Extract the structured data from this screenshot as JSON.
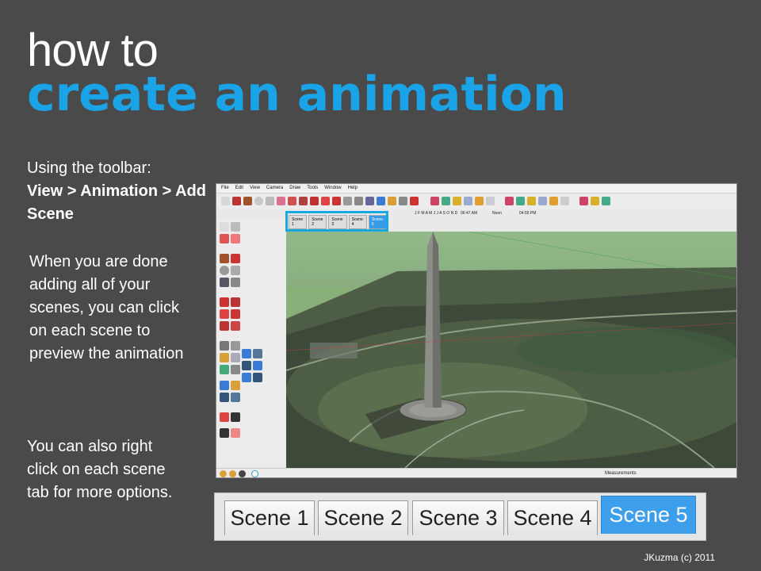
{
  "title": {
    "line1": "how to",
    "line2": "create an animation"
  },
  "instructions": {
    "intro": "Using the toolbar:",
    "path": "View > Animation > Add Scene",
    "preview": "When you are done adding all of your scenes, you can click on each scene to preview the animation",
    "right_click": "You can also right click on each scene tab for more options."
  },
  "screenshot": {
    "menu": [
      "File",
      "Edit",
      "View",
      "Camera",
      "Draw",
      "Tools",
      "Window",
      "Help"
    ],
    "scene_tabs": [
      "Scene 1",
      "Scene 2",
      "Scene 3",
      "Scene 4",
      "Scene 5"
    ],
    "active_scene": "Scene 5",
    "months": "J F M A M J J A S O N D",
    "time_start": "06:47 AM",
    "time_mid": "Noon",
    "time_end": "04:55 PM",
    "status_label": "Measurements"
  },
  "big_tabs": {
    "tabs": [
      "Scene 1",
      "Scene 2",
      "Scene 3",
      "Scene 4",
      "Scene 5"
    ],
    "active": "Scene 5"
  },
  "footer": "JKuzma (c) 2011",
  "colors": {
    "background": "#4a4a4a",
    "accent": "#1aa3e6",
    "active_tab": "#3d9eeb"
  }
}
